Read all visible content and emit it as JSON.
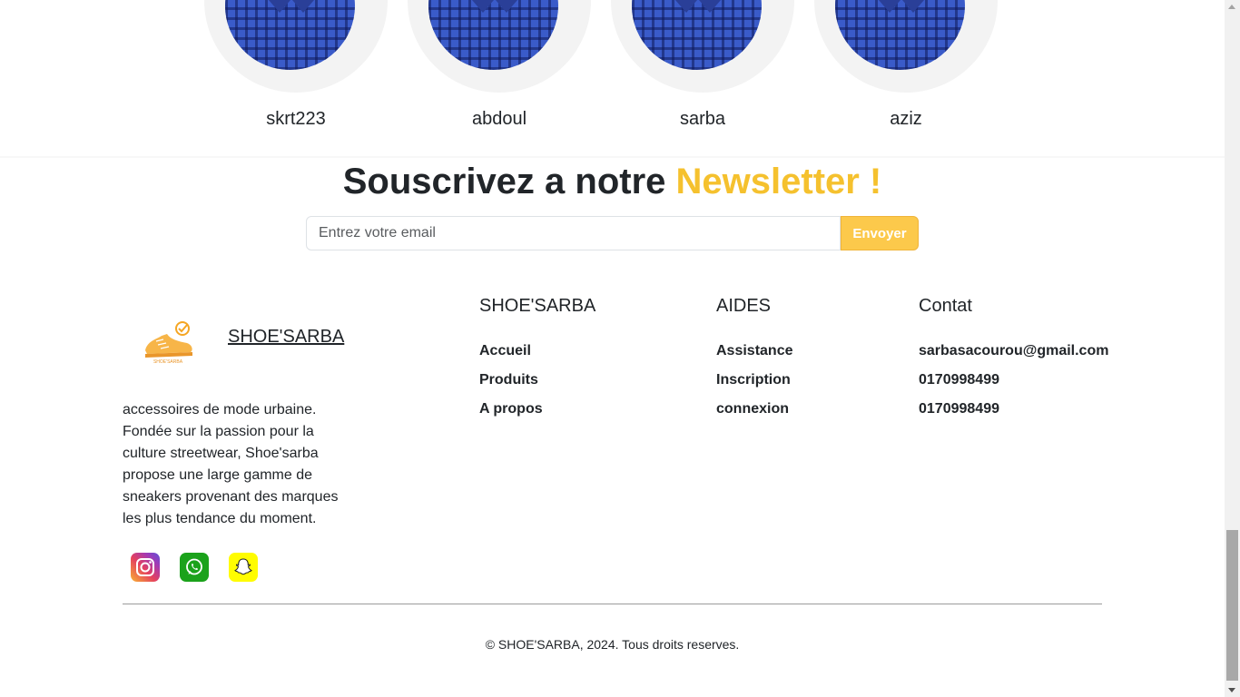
{
  "team": {
    "members": [
      {
        "name": "skrt223"
      },
      {
        "name": "abdoul"
      },
      {
        "name": "sarba"
      },
      {
        "name": "aziz"
      }
    ]
  },
  "newsletter": {
    "title_prefix": "Souscrivez a notre ",
    "title_highlight": "Newsletter !",
    "email_placeholder": "Entrez votre email",
    "email_value": "",
    "submit_label": "Envoyer",
    "accent_color": "#f5c12e"
  },
  "footer": {
    "brand": {
      "name": "SHOE'SARBA",
      "logo_icon": "sneaker-logo-icon",
      "logo_text": "SHOE'SARBA",
      "description": "accessoires de mode urbaine. Fondée sur la passion pour la culture streetwear, Shoe'sarba propose une large gamme de sneakers provenant des marques les plus tendance du moment."
    },
    "socials": [
      {
        "name": "instagram",
        "icon": "instagram-icon"
      },
      {
        "name": "whatsapp",
        "icon": "whatsapp-icon"
      },
      {
        "name": "snapchat",
        "icon": "snapchat-icon"
      }
    ],
    "columns": [
      {
        "title": "SHOE'SARBA",
        "links": [
          "Accueil",
          "Produits",
          "A propos"
        ]
      },
      {
        "title": "AIDES",
        "links": [
          "Assistance",
          "Inscription",
          "connexion"
        ]
      },
      {
        "title": "Contat",
        "links": [
          "sarbasacourou@gmail.com",
          "0170998499",
          "0170998499"
        ]
      }
    ],
    "copyright": "© SHOE'SARBA, 2024. Tous droits reserves."
  }
}
